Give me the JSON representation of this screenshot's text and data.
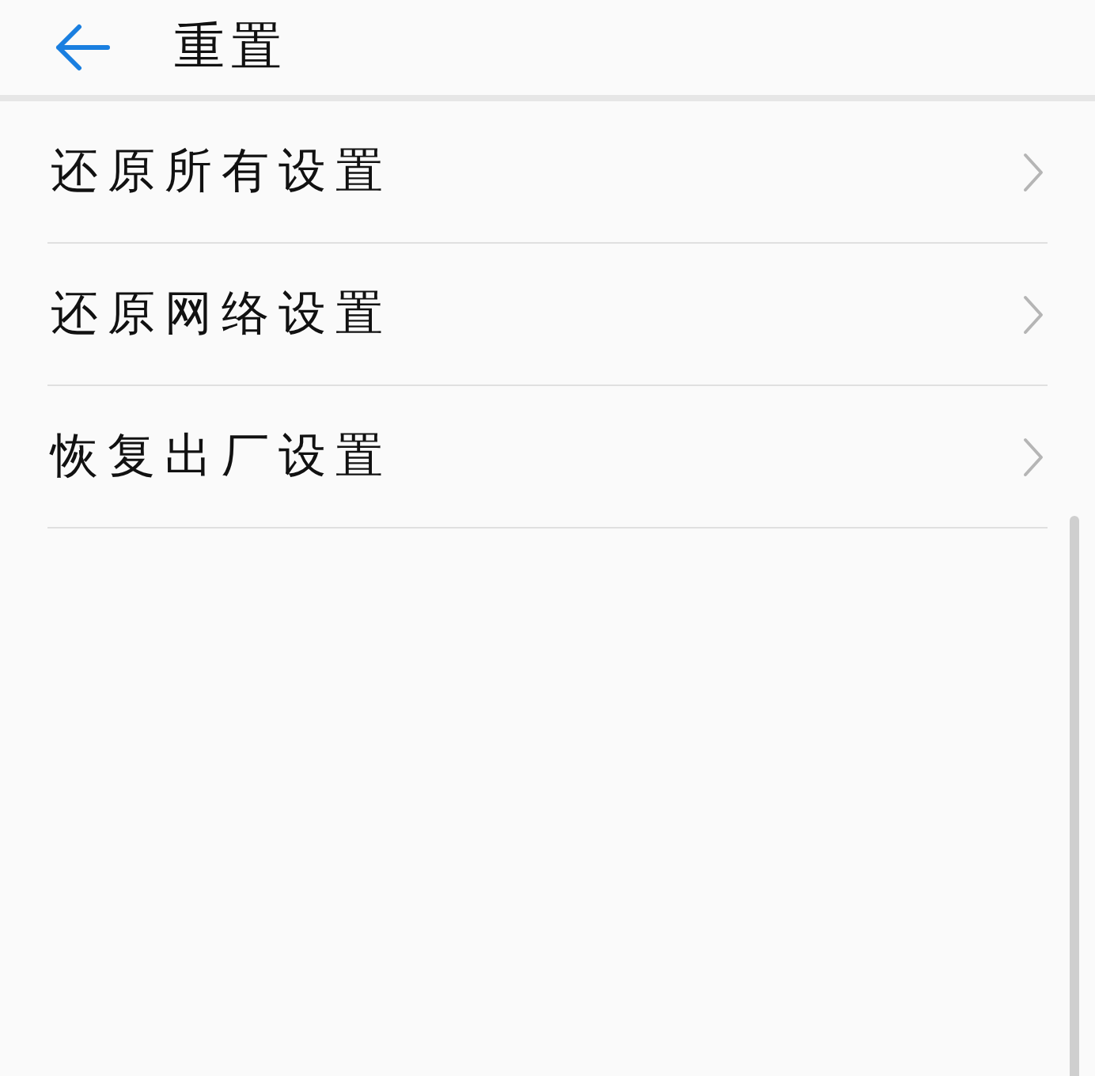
{
  "header": {
    "title": "重置"
  },
  "items": [
    {
      "label": "还原所有设置"
    },
    {
      "label": "还原网络设置"
    },
    {
      "label": "恢复出厂设置"
    }
  ]
}
